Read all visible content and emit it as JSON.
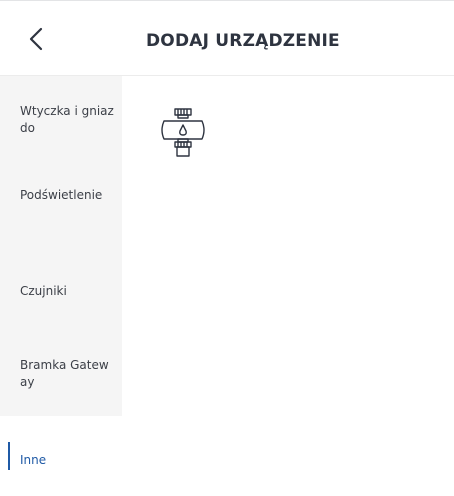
{
  "header": {
    "title": "DODAJ URZĄDZENIE",
    "back_icon": "chevron-left-icon"
  },
  "sidebar": {
    "items": [
      {
        "label": "Wtyczka i gniazdo",
        "active": false
      },
      {
        "label": "Podświetlenie",
        "active": false
      },
      {
        "label": "Czujniki",
        "active": false
      },
      {
        "label": "Bramka Gateway",
        "active": false
      },
      {
        "label": "Inne",
        "active": true
      }
    ]
  },
  "content": {
    "devices": [
      {
        "icon": "water-valve-icon"
      }
    ]
  },
  "colors": {
    "accent": "#1f5aa6",
    "sidebar_background": "#f5f5f5",
    "text": "#333a45"
  }
}
